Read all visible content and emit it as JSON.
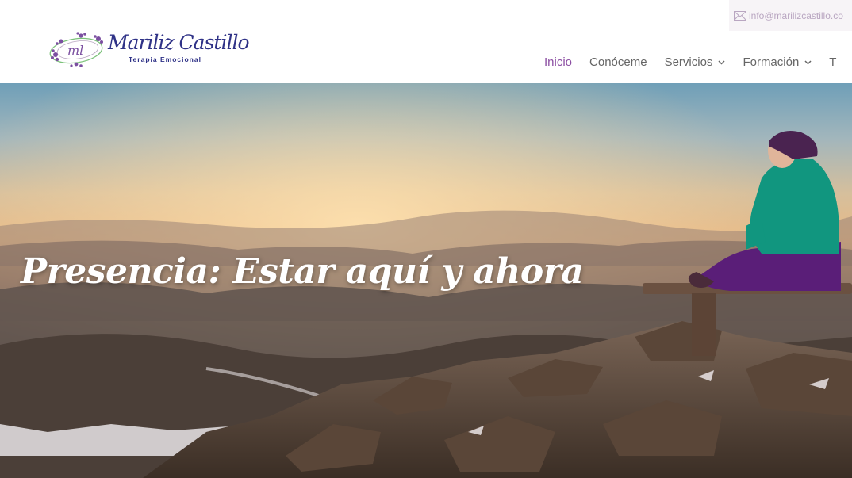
{
  "topbar": {
    "email": "info@marilizcastillo.co",
    "icon": "envelope-icon"
  },
  "logo": {
    "name": "Mariliz Castillo",
    "subtitle": "Terapia Emocional",
    "monogram": "ml",
    "colors": {
      "text": "#2f3287",
      "flowers": "#7b4fa0",
      "leaves": "#7cc27a"
    }
  },
  "nav": {
    "items": [
      {
        "label": "Inicio",
        "active": true,
        "has_dropdown": false
      },
      {
        "label": "Conóceme",
        "active": false,
        "has_dropdown": false
      },
      {
        "label": "Servicios",
        "active": false,
        "has_dropdown": true
      },
      {
        "label": "Formación",
        "active": false,
        "has_dropdown": true
      },
      {
        "label": "T",
        "active": false,
        "has_dropdown": false
      }
    ],
    "active_color": "#8c4fa3",
    "color": "#666666"
  },
  "hero": {
    "title": "Presencia: Estar aquí y ahora",
    "image": "woman meditating on a bench on a rocky mountain top at sunset"
  }
}
